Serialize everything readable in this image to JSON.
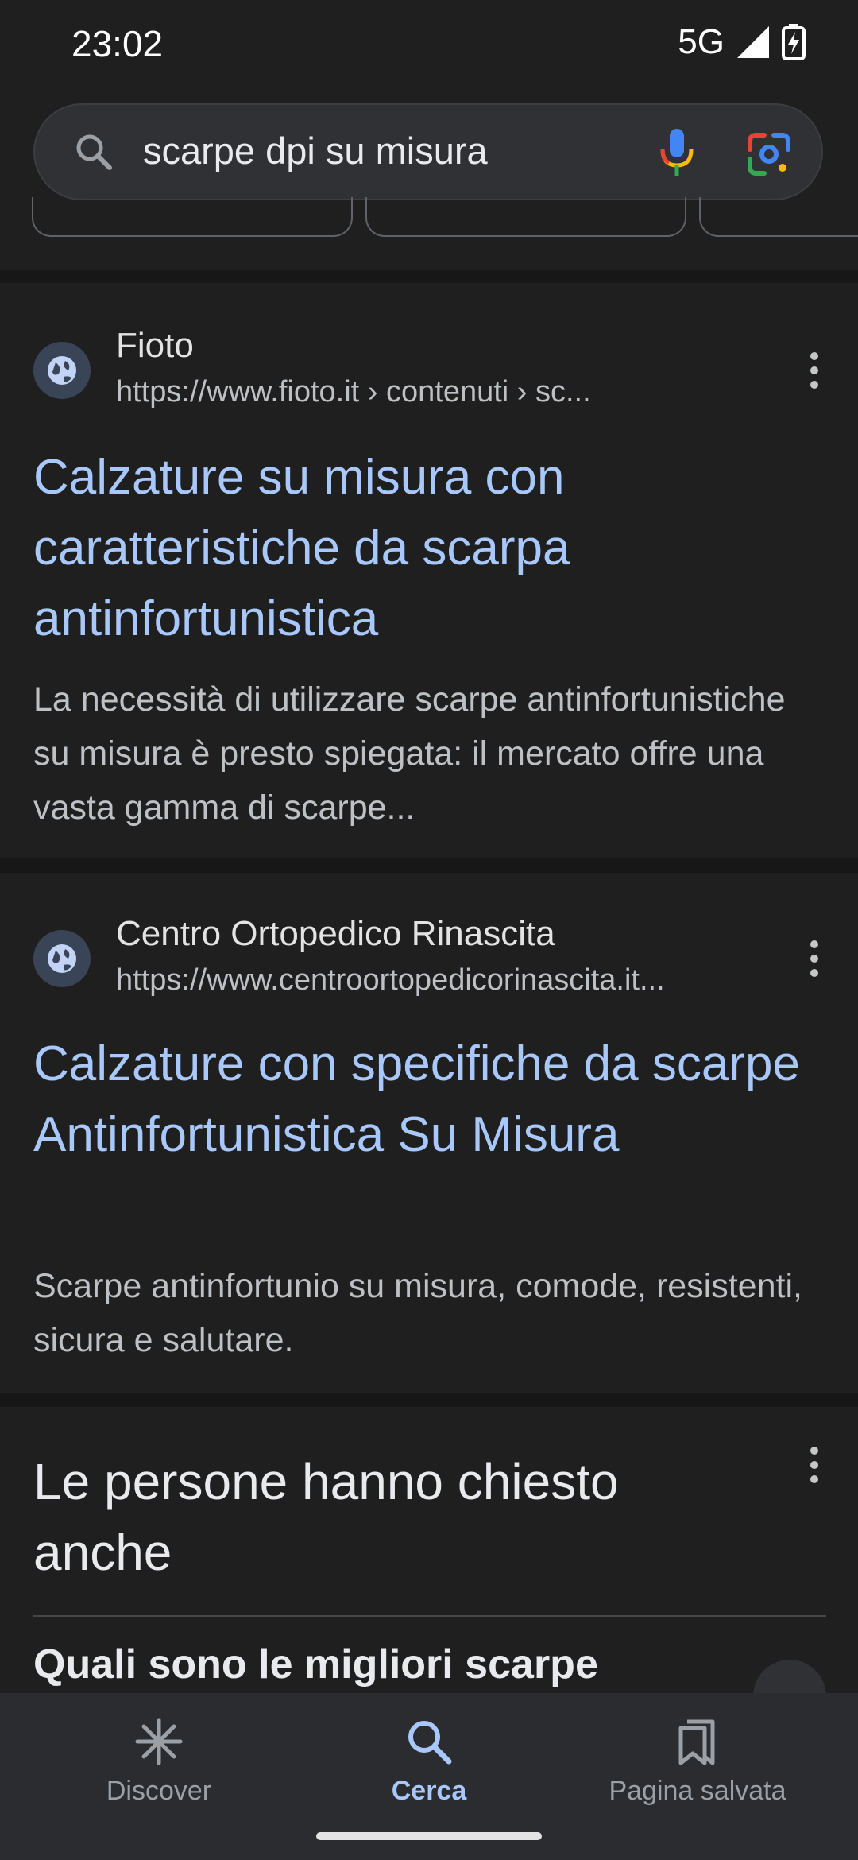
{
  "status_bar": {
    "time": "23:02",
    "network": "5G",
    "icons": [
      "signal-icon",
      "battery-charging-icon"
    ]
  },
  "search": {
    "query": "scarpe dpi su misura",
    "icons": [
      "search-icon",
      "mic-icon",
      "lens-icon"
    ]
  },
  "results": [
    {
      "site": "Fioto",
      "url": "https://www.fioto.it › contenuti › sc...",
      "title": "Calzature su misura con caratteristiche da scarpa antinfortunistica",
      "snippet": "La necessità di utilizzare scarpe antinfortunistiche su misura è presto spiegata: il mercato offre una vasta gamma di scarpe..."
    },
    {
      "site": "Centro Ortopedico Rinascita",
      "url": "https://www.centroortopedicorinascita.it...",
      "title": "Calzature con specifiche da scarpe Antinfortunistica Su Misura",
      "snippet": "Scarpe antinfortunio su misura, comode, resistenti, sicura e salutare."
    }
  ],
  "people_also_ask": {
    "title": "Le persone hanno chiesto anche",
    "first_question": "Quali sono le migliori scarpe"
  },
  "bottom_nav": {
    "items": [
      {
        "label": "Discover",
        "icon": "asterisk-icon",
        "active": false
      },
      {
        "label": "Cerca",
        "icon": "search-icon",
        "active": true
      },
      {
        "label": "Pagina salvata",
        "icon": "bookmarks-icon",
        "active": false
      }
    ]
  },
  "colors": {
    "background": "#1f1f1f",
    "link": "#a8c7fa",
    "text": "#e3e3e3",
    "muted": "#bdc1c6"
  }
}
